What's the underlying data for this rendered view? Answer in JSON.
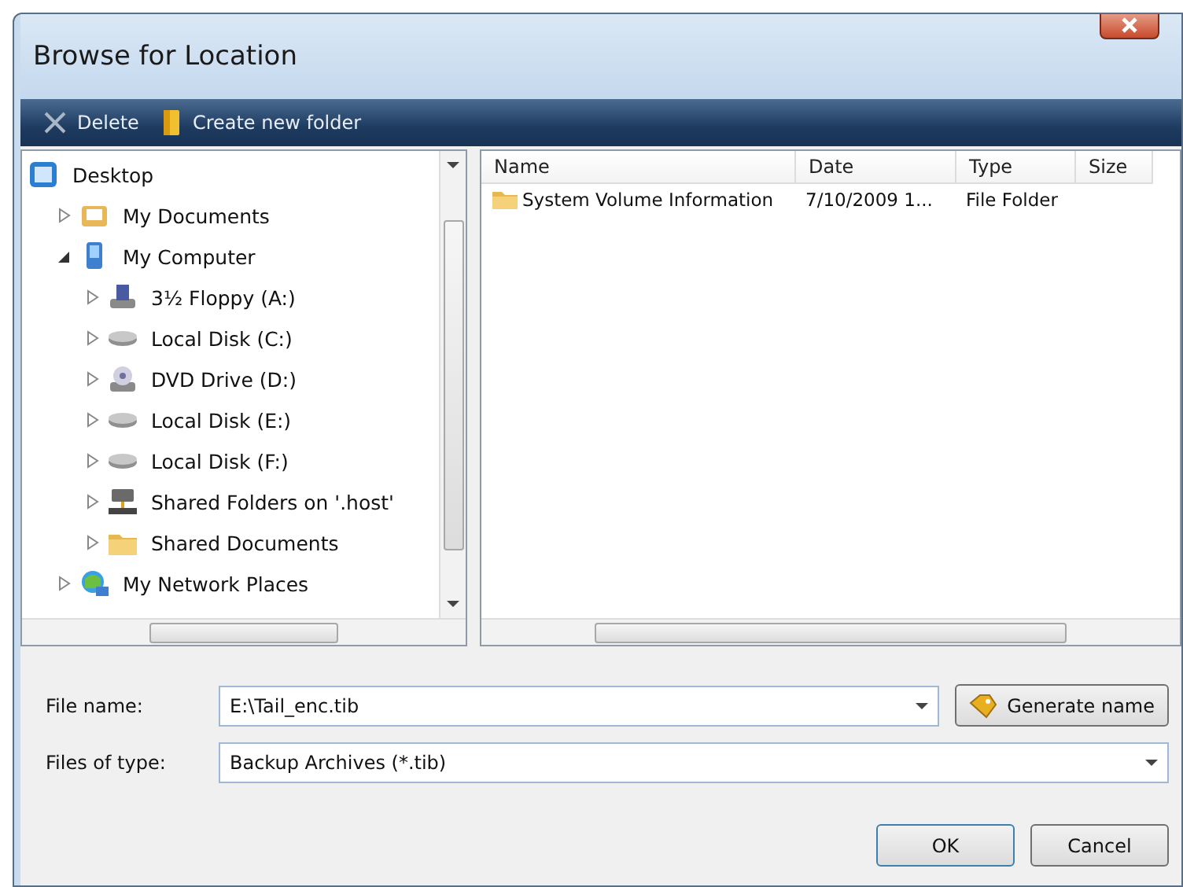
{
  "window": {
    "title": "Browse for Location"
  },
  "toolbar": [
    {
      "label": "Delete",
      "kind": "delete"
    },
    {
      "label": "Create new folder",
      "kind": "folder"
    }
  ],
  "tree": [
    {
      "label": "Desktop",
      "kind": "desktop",
      "children": [
        {
          "label": "My Documents",
          "kind": "documents",
          "expanded": false
        },
        {
          "label": "My Computer",
          "kind": "computer",
          "expanded": true,
          "children": [
            {
              "label": "3½ Floppy (A:)",
              "kind": "floppy",
              "expanded": false
            },
            {
              "label": "Local Disk (C:)",
              "kind": "disk",
              "expanded": false
            },
            {
              "label": "DVD Drive (D:)",
              "kind": "dvd",
              "expanded": false
            },
            {
              "label": "Local Disk (E:)",
              "kind": "disk",
              "expanded": false
            },
            {
              "label": "Local Disk (F:)",
              "kind": "disk",
              "expanded": false
            },
            {
              "label": "Shared Folders on '.host'",
              "kind": "share",
              "expanded": false
            },
            {
              "label": "Shared Documents",
              "kind": "folder",
              "expanded": false
            }
          ]
        },
        {
          "label": "My Network Places",
          "kind": "network",
          "expanded": false
        }
      ]
    }
  ],
  "table": {
    "columns": [
      "Name",
      "Date",
      "Type",
      "Size"
    ],
    "rows": [
      {
        "name": "System Volume Information",
        "date": "7/10/2009 1...",
        "type": "File Folder"
      }
    ]
  },
  "file_name": {
    "label": "File name:",
    "value": "E:\\Tail_enc.tib"
  },
  "generate_button": "Generate name",
  "file_type": {
    "label": "Files of type:",
    "value": "Backup Archives (*.tib)"
  },
  "buttons": [
    "OK",
    "Cancel"
  ]
}
